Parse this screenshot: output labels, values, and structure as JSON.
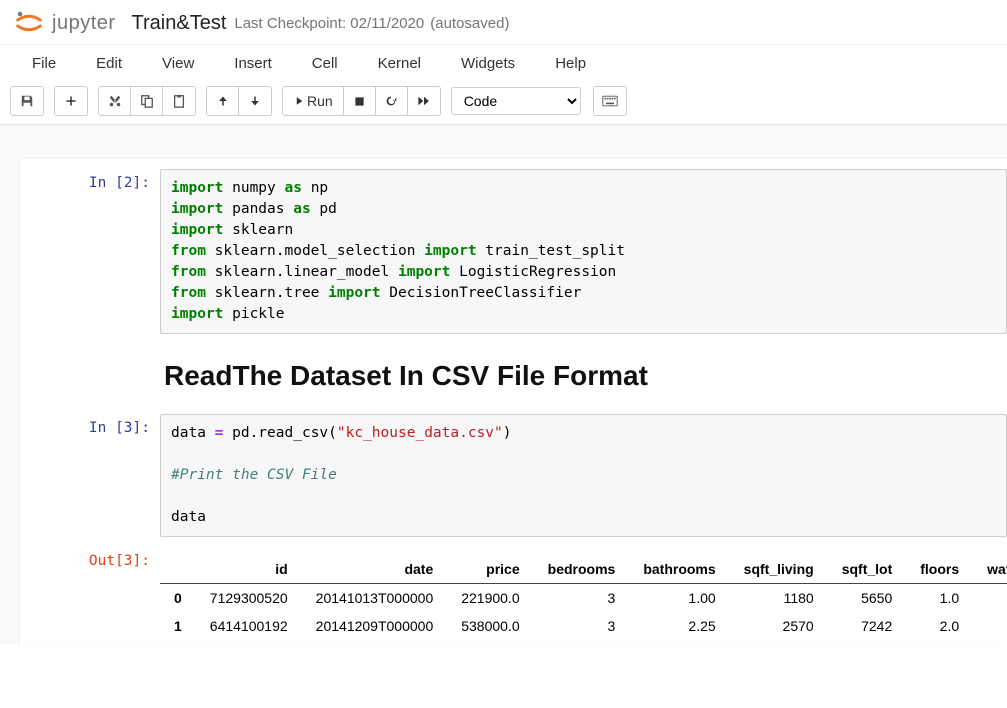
{
  "header": {
    "logo_text": "jupyter",
    "title": "Train&Test",
    "checkpoint": "Last Checkpoint: 02/11/2020",
    "autosaved": "(autosaved)"
  },
  "menu": {
    "file": "File",
    "edit": "Edit",
    "view": "View",
    "insert": "Insert",
    "cell": "Cell",
    "kernel": "Kernel",
    "widgets": "Widgets",
    "help": "Help"
  },
  "toolbar": {
    "run_label": "Run",
    "cell_type": "Code"
  },
  "cells": {
    "c1": {
      "prompt": "In [2]:",
      "code": {
        "l1a": "import",
        "l1b": " numpy ",
        "l1c": "as",
        "l1d": " np",
        "l2a": "import",
        "l2b": " pandas ",
        "l2c": "as",
        "l2d": " pd",
        "l3a": "import",
        "l3b": " sklearn",
        "l4a": "from",
        "l4b": " sklearn.model_selection ",
        "l4c": "import",
        "l4d": " train_test_split",
        "l5a": "from",
        "l5b": " sklearn.linear_model ",
        "l5c": "import",
        "l5d": " LogisticRegression",
        "l6a": "from",
        "l6b": " sklearn.tree ",
        "l6c": "import",
        "l6d": " DecisionTreeClassifier",
        "l7a": "import",
        "l7b": " pickle"
      }
    },
    "md1": {
      "heading": "ReadThe Dataset In CSV File Format"
    },
    "c2": {
      "prompt": "In [3]:",
      "code": {
        "l1a": "data ",
        "l1b": "=",
        "l1c": " pd.read_csv(",
        "l1d": "\"kc_house_data.csv\"",
        "l1e": ")",
        "l2": "",
        "l3": "#Print the CSV File",
        "l4": "",
        "l5": "data"
      }
    },
    "out2": {
      "prompt": "Out[3]:",
      "columns": [
        "",
        "id",
        "date",
        "price",
        "bedrooms",
        "bathrooms",
        "sqft_living",
        "sqft_lot",
        "floors",
        "waterfron"
      ],
      "rows": [
        {
          "idx": "0",
          "cells": [
            "7129300520",
            "20141013T000000",
            "221900.0",
            "3",
            "1.00",
            "1180",
            "5650",
            "1.0"
          ]
        },
        {
          "idx": "1",
          "cells": [
            "6414100192",
            "20141209T000000",
            "538000.0",
            "3",
            "2.25",
            "2570",
            "7242",
            "2.0"
          ]
        }
      ]
    }
  }
}
